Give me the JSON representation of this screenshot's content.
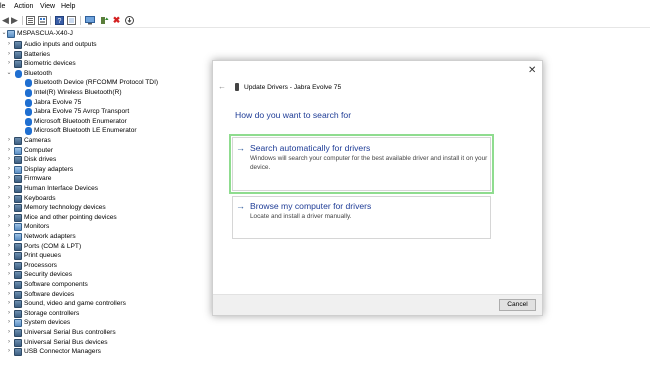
{
  "menu": {
    "file": "le",
    "action": "Action",
    "view": "View",
    "help": "Help"
  },
  "toolbar_icons": [
    "back-icon",
    "forward-icon",
    "device-manager-icon",
    "properties-icon",
    "refresh-icon",
    "help-icon",
    "show-hidden-icon",
    "monitor-icon",
    "update-driver-icon",
    "uninstall-icon",
    "scan-hardware-icon"
  ],
  "tree": {
    "root": "MSPASCUA-X40-J",
    "categories": [
      "Audio inputs and outputs",
      "Batteries",
      "Biometric devices",
      "Bluetooth"
    ],
    "bluetooth_children": [
      "Bluetooth Device (RFCOMM Protocol TDI)",
      "Intel(R) Wireless Bluetooth(R)",
      "Jabra Evolve 75",
      "Jabra Evolve 75 Avrcp Transport",
      "Microsoft Bluetooth Enumerator",
      "Microsoft Bluetooth LE Enumerator"
    ],
    "more_categories": [
      "Cameras",
      "Computer",
      "Disk drives",
      "Display adapters",
      "Firmware",
      "Human Interface Devices",
      "Keyboards",
      "Memory technology devices",
      "Mice and other pointing devices",
      "Monitors",
      "Network adapters",
      "Ports (COM & LPT)",
      "Print queues",
      "Processors",
      "Security devices",
      "Software components",
      "Software devices",
      "Sound, video and game controllers",
      "Storage controllers",
      "System devices",
      "Universal Serial Bus controllers",
      "Universal Serial Bus devices",
      "USB Connector Managers"
    ]
  },
  "dialog": {
    "title": "Update Drivers - Jabra Evolve 75",
    "heading": "How do you want to search for",
    "option1_title": "Search automatically for drivers",
    "option1_desc": "Windows will search your computer for the best available driver and install it on your device.",
    "option2_title": "Browse my computer for drivers",
    "option2_desc": "Locate and install a driver manually.",
    "cancel": "Cancel",
    "close_glyph": "✕",
    "back_glyph": "←",
    "arrow_glyph": "→"
  },
  "colors": {
    "link_blue": "#1e3c96",
    "highlight_green": "#8fdc8f",
    "bluetooth_blue": "#1f6fd1"
  }
}
